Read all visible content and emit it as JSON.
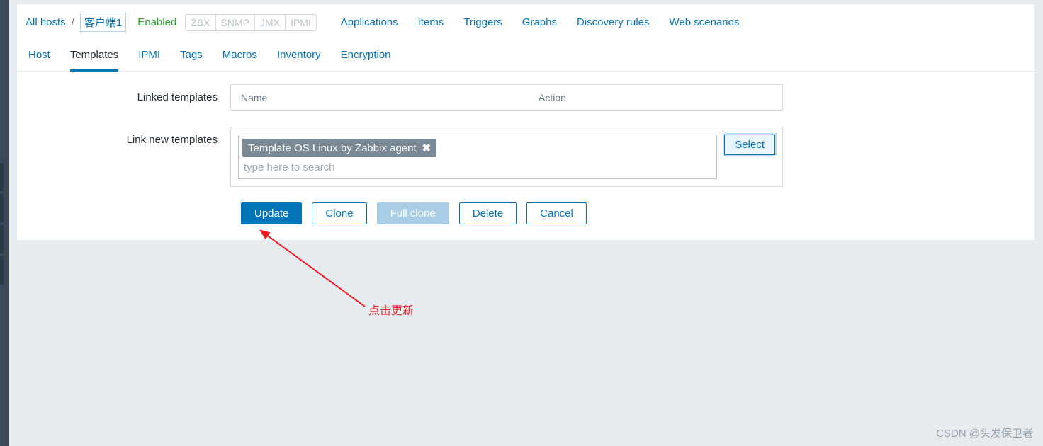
{
  "breadcrumb": {
    "all_hosts": "All hosts",
    "current_host": "客户端1"
  },
  "status_label": "Enabled",
  "protocols": [
    "ZBX",
    "SNMP",
    "JMX",
    "IPMI"
  ],
  "nav_links": [
    "Applications",
    "Items",
    "Triggers",
    "Graphs",
    "Discovery rules",
    "Web scenarios"
  ],
  "tabs": [
    "Host",
    "Templates",
    "IPMI",
    "Tags",
    "Macros",
    "Inventory",
    "Encryption"
  ],
  "active_tab": "Templates",
  "form": {
    "linked_templates_label": "Linked templates",
    "linked_headers": {
      "name": "Name",
      "action": "Action"
    },
    "link_new_label": "Link new templates",
    "selected_template": "Template OS Linux by Zabbix agent",
    "search_placeholder": "type here to search",
    "select_button": "Select"
  },
  "buttons": {
    "update": "Update",
    "clone": "Clone",
    "full_clone": "Full clone",
    "delete": "Delete",
    "cancel": "Cancel"
  },
  "annotation_text": "点击更新",
  "watermark": "CSDN @头发保卫者"
}
